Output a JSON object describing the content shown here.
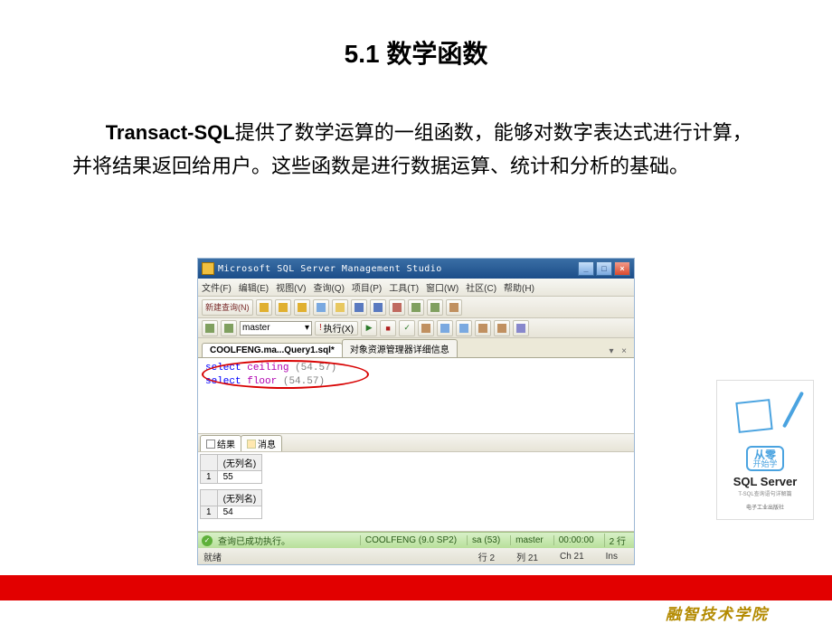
{
  "slide": {
    "title": "5.1  数学函数",
    "body_prefix_bold": "Transact-SQL",
    "body_rest": "提供了数学运算的一组函数，能够对数字表达式进行计算，并将结果返回给用户。这些函数是进行数据运算、统计和分析的基础。"
  },
  "app": {
    "title": "Microsoft SQL Server Management Studio",
    "menu": [
      "文件(F)",
      "编辑(E)",
      "视图(V)",
      "查询(Q)",
      "项目(P)",
      "工具(T)",
      "窗口(W)",
      "社区(C)",
      "帮助(H)"
    ],
    "new_query": "新建查询(N)",
    "db_select": "master",
    "execute": "执行(X)",
    "tabs": {
      "active": "COOLFENG.ma...Query1.sql*",
      "other": "对象资源管理器详细信息"
    },
    "code": {
      "l1_select": "select",
      "l1_func": "ceiling",
      "l1_arg": "(54.57)",
      "l2_select": "select",
      "l2_func": "floor",
      "l2_arg": "(54.57)"
    },
    "result_tabs": {
      "results": "结果",
      "messages": "消息"
    },
    "grid": {
      "col_noname": "(无列名)",
      "r1": "55",
      "r2": "54",
      "rowno": "1"
    },
    "status1": {
      "msg": "查询已成功执行。",
      "server": "COOLFENG (9.0 SP2)",
      "user": "sa (53)",
      "db": "master",
      "time": "00:00:00",
      "rows": "2 行"
    },
    "status2": {
      "ready": "就绪",
      "line": "行 2",
      "col": "列 21",
      "ch": "Ch 21",
      "ins": "Ins"
    }
  },
  "book": {
    "badge_top": "从零",
    "badge_bottom": "开始学",
    "title": "SQL Server",
    "sub": "T-SQL查询语句详解篇",
    "publisher": "电子工业出版社"
  },
  "footer": "融智技术学院"
}
